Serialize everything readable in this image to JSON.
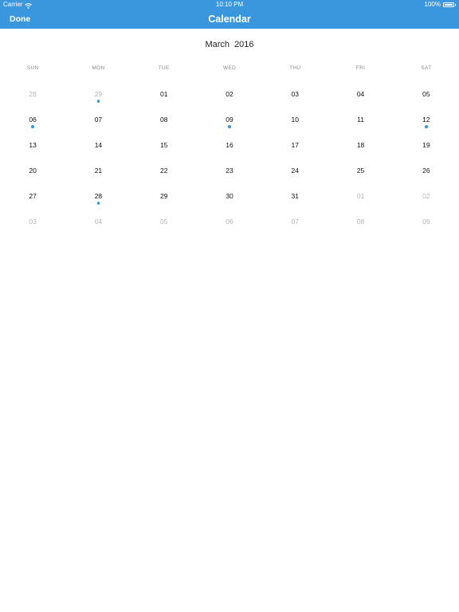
{
  "status_bar": {
    "carrier": "Carrier",
    "time": "10:10 PM",
    "battery": "100%",
    "battery_level": 1.0
  },
  "nav": {
    "done_label": "Done",
    "title": "Calendar"
  },
  "calendar": {
    "month": "March",
    "year": "2016",
    "weekdays": [
      "SUN",
      "MON",
      "TUE",
      "WED",
      "THU",
      "FRI",
      "SAT"
    ],
    "accent_color": "#3a97de",
    "weeks": [
      [
        {
          "day": "28",
          "muted": true,
          "event": false
        },
        {
          "day": "29",
          "muted": true,
          "event": true
        },
        {
          "day": "01",
          "muted": false,
          "event": false
        },
        {
          "day": "02",
          "muted": false,
          "event": false
        },
        {
          "day": "03",
          "muted": false,
          "event": false
        },
        {
          "day": "04",
          "muted": false,
          "event": false
        },
        {
          "day": "05",
          "muted": false,
          "event": false
        }
      ],
      [
        {
          "day": "06",
          "muted": false,
          "event": true
        },
        {
          "day": "07",
          "muted": false,
          "event": false
        },
        {
          "day": "08",
          "muted": false,
          "event": false
        },
        {
          "day": "09",
          "muted": false,
          "event": true
        },
        {
          "day": "10",
          "muted": false,
          "event": false
        },
        {
          "day": "11",
          "muted": false,
          "event": false
        },
        {
          "day": "12",
          "muted": false,
          "event": true
        }
      ],
      [
        {
          "day": "13",
          "muted": false,
          "event": false
        },
        {
          "day": "14",
          "muted": false,
          "event": false
        },
        {
          "day": "15",
          "muted": false,
          "event": false
        },
        {
          "day": "16",
          "muted": false,
          "event": false
        },
        {
          "day": "17",
          "muted": false,
          "event": false
        },
        {
          "day": "18",
          "muted": false,
          "event": false
        },
        {
          "day": "19",
          "muted": false,
          "event": false
        }
      ],
      [
        {
          "day": "20",
          "muted": false,
          "event": false
        },
        {
          "day": "21",
          "muted": false,
          "event": false
        },
        {
          "day": "22",
          "muted": false,
          "event": false
        },
        {
          "day": "23",
          "muted": false,
          "event": false
        },
        {
          "day": "24",
          "muted": false,
          "event": false
        },
        {
          "day": "25",
          "muted": false,
          "event": false
        },
        {
          "day": "26",
          "muted": false,
          "event": false
        }
      ],
      [
        {
          "day": "27",
          "muted": false,
          "event": false
        },
        {
          "day": "28",
          "muted": false,
          "event": true
        },
        {
          "day": "29",
          "muted": false,
          "event": false
        },
        {
          "day": "30",
          "muted": false,
          "event": false
        },
        {
          "day": "31",
          "muted": false,
          "event": false
        },
        {
          "day": "01",
          "muted": true,
          "event": false
        },
        {
          "day": "02",
          "muted": true,
          "event": false
        }
      ],
      [
        {
          "day": "03",
          "muted": true,
          "event": false
        },
        {
          "day": "04",
          "muted": true,
          "event": false
        },
        {
          "day": "05",
          "muted": true,
          "event": false
        },
        {
          "day": "06",
          "muted": true,
          "event": false
        },
        {
          "day": "07",
          "muted": true,
          "event": false
        },
        {
          "day": "08",
          "muted": true,
          "event": false
        },
        {
          "day": "09",
          "muted": true,
          "event": false
        }
      ]
    ]
  }
}
